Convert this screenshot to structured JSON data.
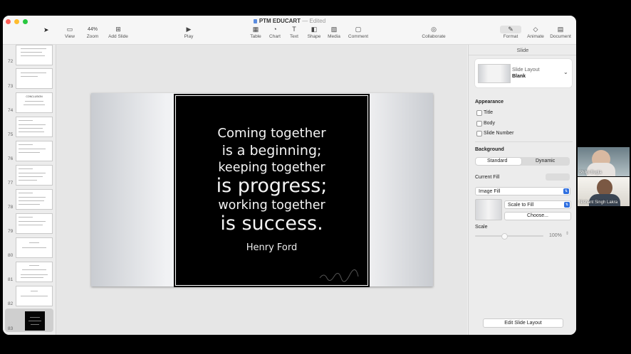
{
  "window": {
    "title": "PTM EDUCART",
    "title_suffix": "Edited"
  },
  "toolbar": {
    "view": "View",
    "zoom_value": "44%",
    "zoom": "Zoom",
    "add_slide": "Add Slide",
    "play": "Play",
    "table": "Table",
    "chart": "Chart",
    "text": "Text",
    "shape": "Shape",
    "media": "Media",
    "comment": "Comment",
    "collaborate": "Collaborate",
    "format": "Format",
    "animate": "Animate",
    "document": "Document"
  },
  "sidebar": {
    "slides": [
      {
        "number": "72"
      },
      {
        "number": "73"
      },
      {
        "number": "74",
        "heading": "CONCLUSION"
      },
      {
        "number": "75"
      },
      {
        "number": "76"
      },
      {
        "number": "77"
      },
      {
        "number": "78"
      },
      {
        "number": "79"
      },
      {
        "number": "80"
      },
      {
        "number": "81"
      },
      {
        "number": "82"
      },
      {
        "number": "83",
        "selected": true
      }
    ]
  },
  "slide": {
    "quote_lines": [
      "Coming together",
      "is a beginning;",
      "keeping together",
      "is progress;",
      "working together",
      "is success."
    ],
    "author": "Henry Ford"
  },
  "inspector": {
    "tab": "Slide",
    "layout_label": "Slide Layout",
    "layout_value": "Blank",
    "appearance": "Appearance",
    "title_option": "Title",
    "body_option": "Body",
    "slide_number_option": "Slide Number",
    "background": "Background",
    "standard": "Standard",
    "dynamic": "Dynamic",
    "current_fill": "Current Fill",
    "fill_type": "Image Fill",
    "scale_mode": "Scale to Fill",
    "choose": "Choose...",
    "scale": "Scale",
    "scale_value": "100%",
    "edit_layout": "Edit Slide Layout"
  },
  "participants": [
    {
      "name": "Shilpi Bugla"
    },
    {
      "name": "Nishant Singh Lakra"
    }
  ],
  "colors": {
    "close": "#fe5f57",
    "minimize": "#febc2e",
    "maximize": "#28c840",
    "accent": "#2f6fe0"
  }
}
